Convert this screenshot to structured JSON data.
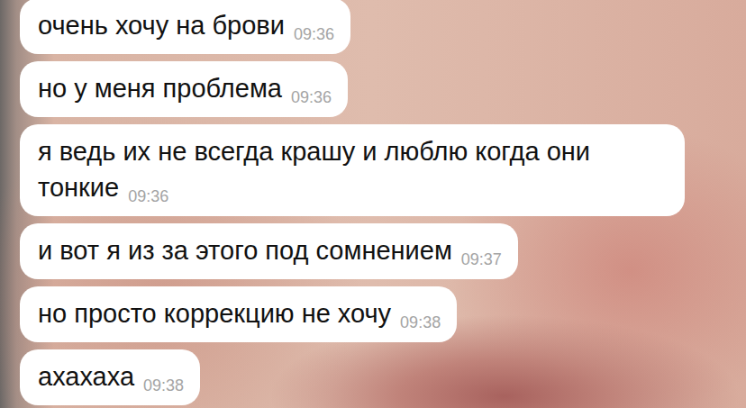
{
  "chat": {
    "messages": [
      {
        "text": "очень хочу на брови",
        "time": "09:36"
      },
      {
        "text": "но у меня проблема",
        "time": "09:36"
      },
      {
        "text": "я ведь их не всегда крашу и люблю когда они тонкие",
        "time": "09:36"
      },
      {
        "text": "и вот я из за этого под сомнением",
        "time": "09:37"
      },
      {
        "text": "но просто коррекцию не хочу",
        "time": "09:38"
      },
      {
        "text": "ахахаха",
        "time": "09:38"
      }
    ]
  }
}
